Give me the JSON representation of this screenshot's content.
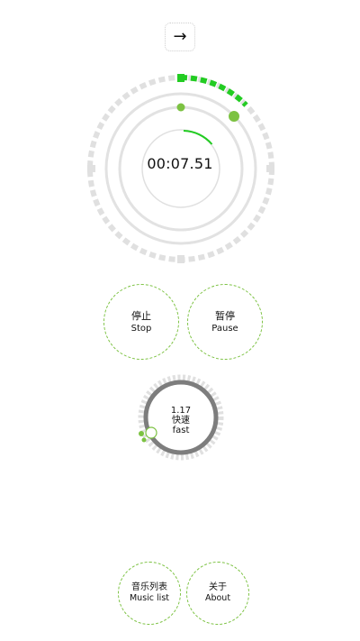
{
  "top_arrow": {
    "icon": "arrow-right-icon",
    "glyph": "→"
  },
  "timer": {
    "time": "00:07.51",
    "accent": "#22cc22",
    "dot_color": "#7cc242",
    "track_color": "#e0e0e0"
  },
  "buttons": {
    "stop": {
      "label_cn": "停止",
      "label_en": "Stop"
    },
    "pause": {
      "label_cn": "暂停",
      "label_en": "Pause"
    }
  },
  "speed": {
    "value": "1.17",
    "label_cn": "快速",
    "label_en": "fast"
  },
  "bottom_nav": {
    "music_list": {
      "label_cn": "音乐列表",
      "label_en": "Music list"
    },
    "about": {
      "label_cn": "关于",
      "label_en": "About"
    }
  }
}
